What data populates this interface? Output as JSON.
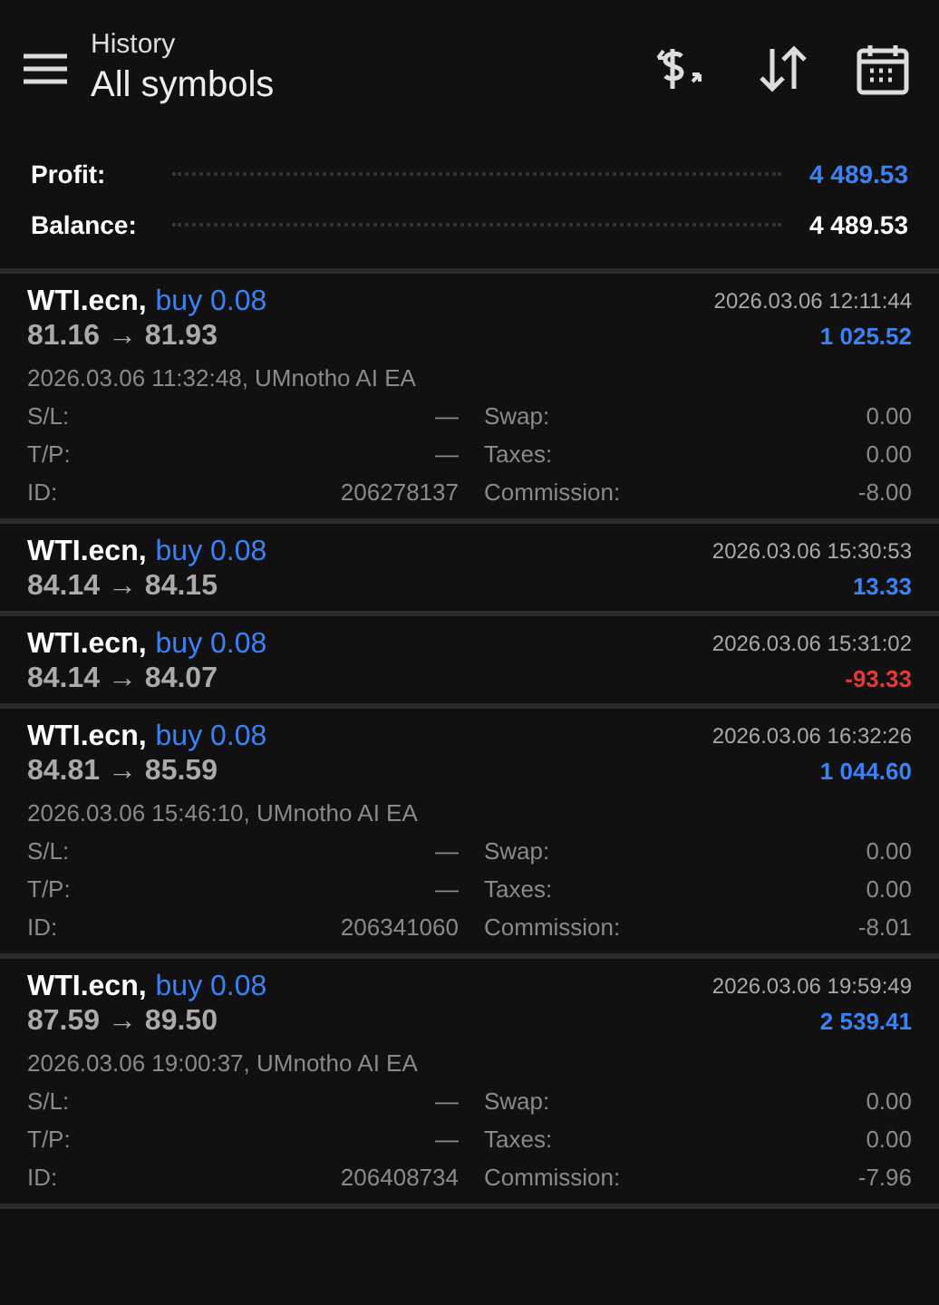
{
  "header": {
    "subtitle": "History",
    "title": "All symbols"
  },
  "summary": [
    {
      "label": "Profit:",
      "value": "4 489.53",
      "highlight": true
    },
    {
      "label": "Balance:",
      "value": "4 489.53",
      "highlight": false
    }
  ],
  "deals": [
    {
      "symbol": "WTI.ecn,",
      "side": "buy 0.08",
      "prices": "81.16 → 81.93",
      "time": "2026.03.06 12:11:44",
      "profit": "1 025.52",
      "color": "#3b82f6",
      "expanded": true,
      "open_info": "2026.03.06 11:32:48, UMnotho AI EA",
      "details": [
        [
          "S/L:",
          "—",
          "Swap:",
          "0.00"
        ],
        [
          "T/P:",
          "—",
          "Taxes:",
          "0.00"
        ],
        [
          "ID:",
          "206278137",
          "Commission:",
          "-8.00"
        ]
      ]
    },
    {
      "symbol": "WTI.ecn,",
      "side": "buy 0.08",
      "prices": "84.14 → 84.15",
      "time": "2026.03.06 15:30:53",
      "profit": "13.33",
      "color": "#3b82f6",
      "expanded": false
    },
    {
      "symbol": "WTI.ecn,",
      "side": "buy 0.08",
      "prices": "84.14 → 84.07",
      "time": "2026.03.06 15:31:02",
      "profit": "-93.33",
      "color": "#e53935",
      "expanded": false
    },
    {
      "symbol": "WTI.ecn,",
      "side": "buy 0.08",
      "prices": "84.81 → 85.59",
      "time": "2026.03.06 16:32:26",
      "profit": "1 044.60",
      "color": "#3b82f6",
      "expanded": true,
      "open_info": "2026.03.06 15:46:10, UMnotho AI EA",
      "details": [
        [
          "S/L:",
          "—",
          "Swap:",
          "0.00"
        ],
        [
          "T/P:",
          "—",
          "Taxes:",
          "0.00"
        ],
        [
          "ID:",
          "206341060",
          "Commission:",
          "-8.01"
        ]
      ]
    },
    {
      "symbol": "WTI.ecn,",
      "side": "buy 0.08",
      "prices": "87.59 → 89.50",
      "time": "2026.03.06 19:59:49",
      "profit": "2 539.41",
      "color": "#3b82f6",
      "expanded": true,
      "open_info": "2026.03.06 19:00:37, UMnotho AI EA",
      "details": [
        [
          "S/L:",
          "—",
          "Swap:",
          "0.00"
        ],
        [
          "T/P:",
          "—",
          "Taxes:",
          "0.00"
        ],
        [
          "ID:",
          "206408734",
          "Commission:",
          "-7.96"
        ]
      ]
    }
  ]
}
